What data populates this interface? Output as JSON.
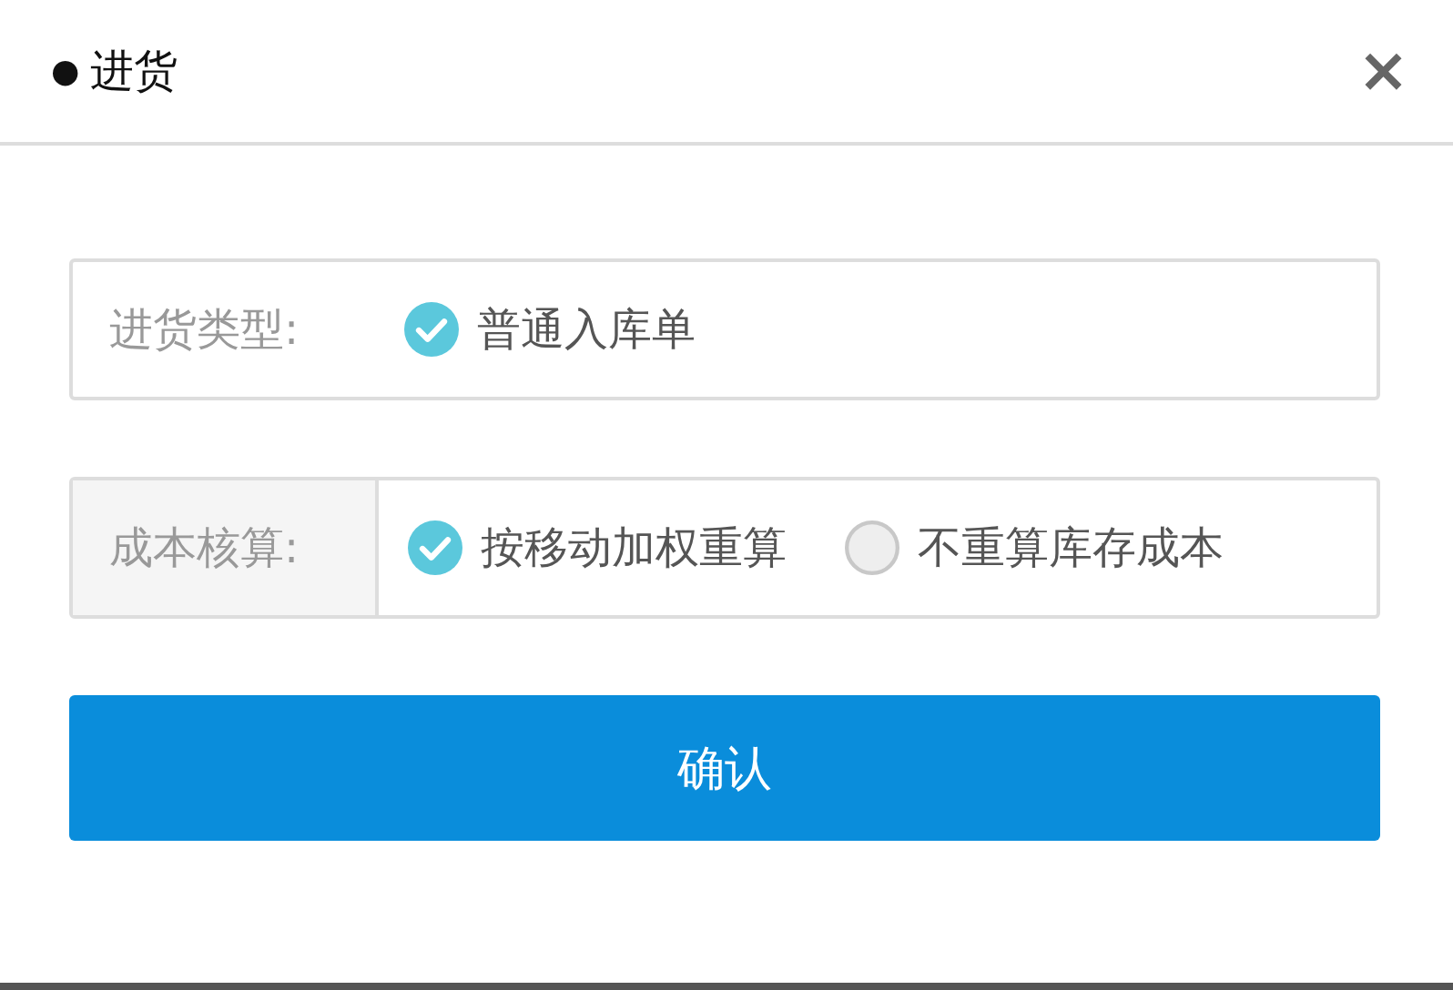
{
  "dialog": {
    "bullet": "●",
    "title": "进货",
    "close": "×"
  },
  "fields": [
    {
      "label": "进货类型:",
      "label_shaded": false,
      "options": [
        {
          "label": "普通入库单",
          "selected": true
        }
      ]
    },
    {
      "label": "成本核算:",
      "label_shaded": true,
      "options": [
        {
          "label": "按移动加权重算",
          "selected": true
        },
        {
          "label": "不重算库存成本",
          "selected": false
        }
      ]
    }
  ],
  "confirm_button": "确认"
}
